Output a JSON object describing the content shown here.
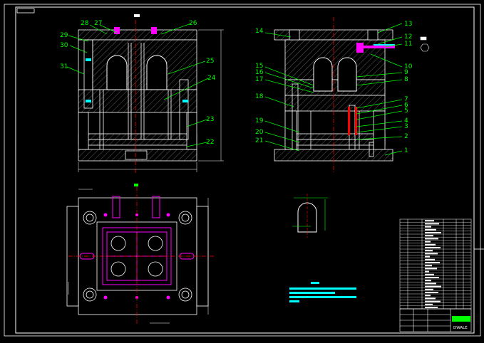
{
  "colors": {
    "background": "#000000",
    "outline": "#ffffff",
    "leader": "#00ff00",
    "centerline": "#ff0000",
    "highlight": "#ff00ff",
    "note": "#00ffff",
    "hatch": "#8a8a8a"
  },
  "labels_front": [
    "28",
    "27",
    "26",
    "29",
    "30",
    "31",
    "25",
    "24",
    "23",
    "22"
  ],
  "labels_side_left": [
    "14",
    "15",
    "16",
    "17",
    "18",
    "19",
    "20",
    "21"
  ],
  "labels_side_right": [
    "13",
    "12",
    "11",
    "10",
    "9",
    "8",
    "7",
    "6",
    "5",
    "4",
    "3",
    "2",
    "1"
  ],
  "title_block_text": "DWALE"
}
